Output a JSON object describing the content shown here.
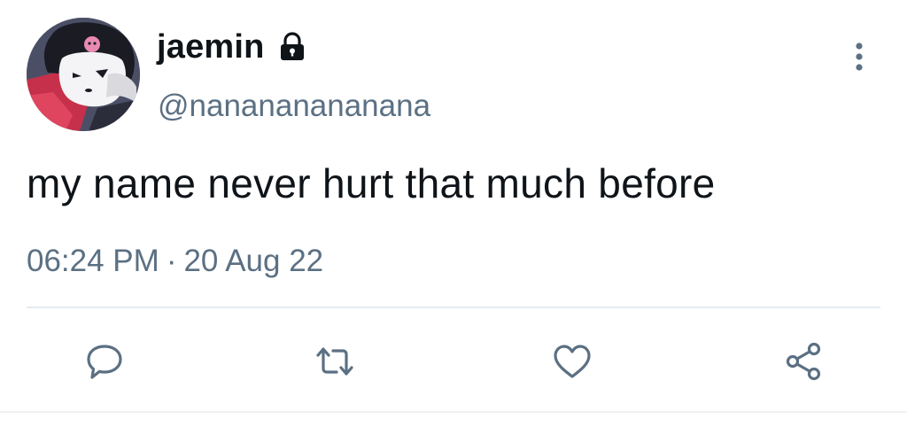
{
  "tweet": {
    "author": {
      "display_name": "jaemin",
      "handle": "@nanananananana",
      "protected_icon": "lock-icon",
      "avatar": "kuromi-avatar"
    },
    "text": "my name never hurt that much before",
    "time": "06:24 PM",
    "separator": "·",
    "date": "20 Aug 22",
    "actions": [
      {
        "name": "reply",
        "icon": "speech-bubble-icon"
      },
      {
        "name": "retweet",
        "icon": "retweet-icon"
      },
      {
        "name": "like",
        "icon": "heart-icon"
      },
      {
        "name": "share",
        "icon": "share-icon"
      }
    ],
    "menu_icon": "more-vertical-icon"
  },
  "colors": {
    "text_primary": "#0f1419",
    "text_secondary": "#5b7083",
    "divider": "#e6ecf0",
    "background": "#ffffff"
  }
}
